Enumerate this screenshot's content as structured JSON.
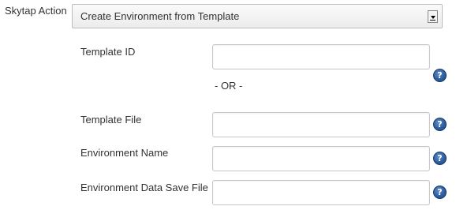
{
  "action": {
    "label": "Skytap Action",
    "selected": "Create Environment from Template"
  },
  "fields": {
    "template_id": {
      "label": "Template ID",
      "value": ""
    },
    "separator": "- OR -",
    "template_file": {
      "label": "Template File",
      "value": ""
    },
    "environment_name": {
      "label": "Environment Name",
      "value": ""
    },
    "env_data_save_file": {
      "label": "Environment Data Save File",
      "value": ""
    }
  },
  "help_glyph": "?",
  "icons": {
    "help": "help-icon",
    "dropdown": "chevron-down-icon"
  },
  "colors": {
    "help_icon": "#2f5f9f",
    "border": "#c6c6c6"
  }
}
